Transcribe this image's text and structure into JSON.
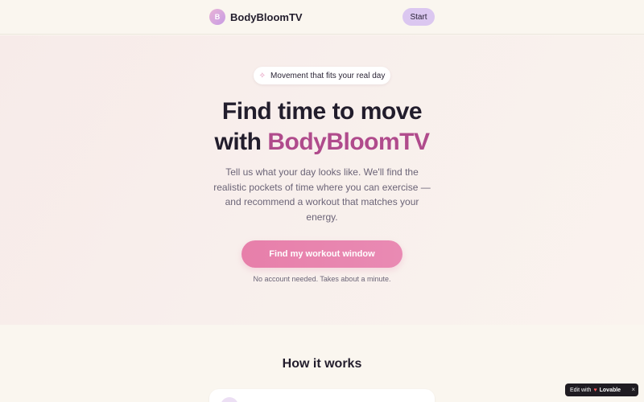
{
  "header": {
    "brand_mark": "B",
    "brand_name": "BodyBloomTV",
    "start_label": "Start"
  },
  "hero": {
    "pill_icon": "sparkle-icon",
    "pill_text": "Movement that fits your real day",
    "title_line1": "Find time to move",
    "title_line2_prefix": "with",
    "title_line2_accent": "BodyBloomTV",
    "subtitle": "Tell us what your day looks like. We'll find the realistic pockets of time where you can exercise — and recommend a workout that matches your energy.",
    "cta_label": "Find my workout window",
    "cta_note": "No account needed. Takes about a minute."
  },
  "how_it_works": {
    "title": "How it works"
  },
  "badge": {
    "prefix": "Edit with",
    "brand": "Lovable",
    "close": "×"
  },
  "colors": {
    "accent": "#b04b8c",
    "cta": "#e77faa",
    "start_button": "#dbc7f0",
    "background": "#faf6ef"
  }
}
